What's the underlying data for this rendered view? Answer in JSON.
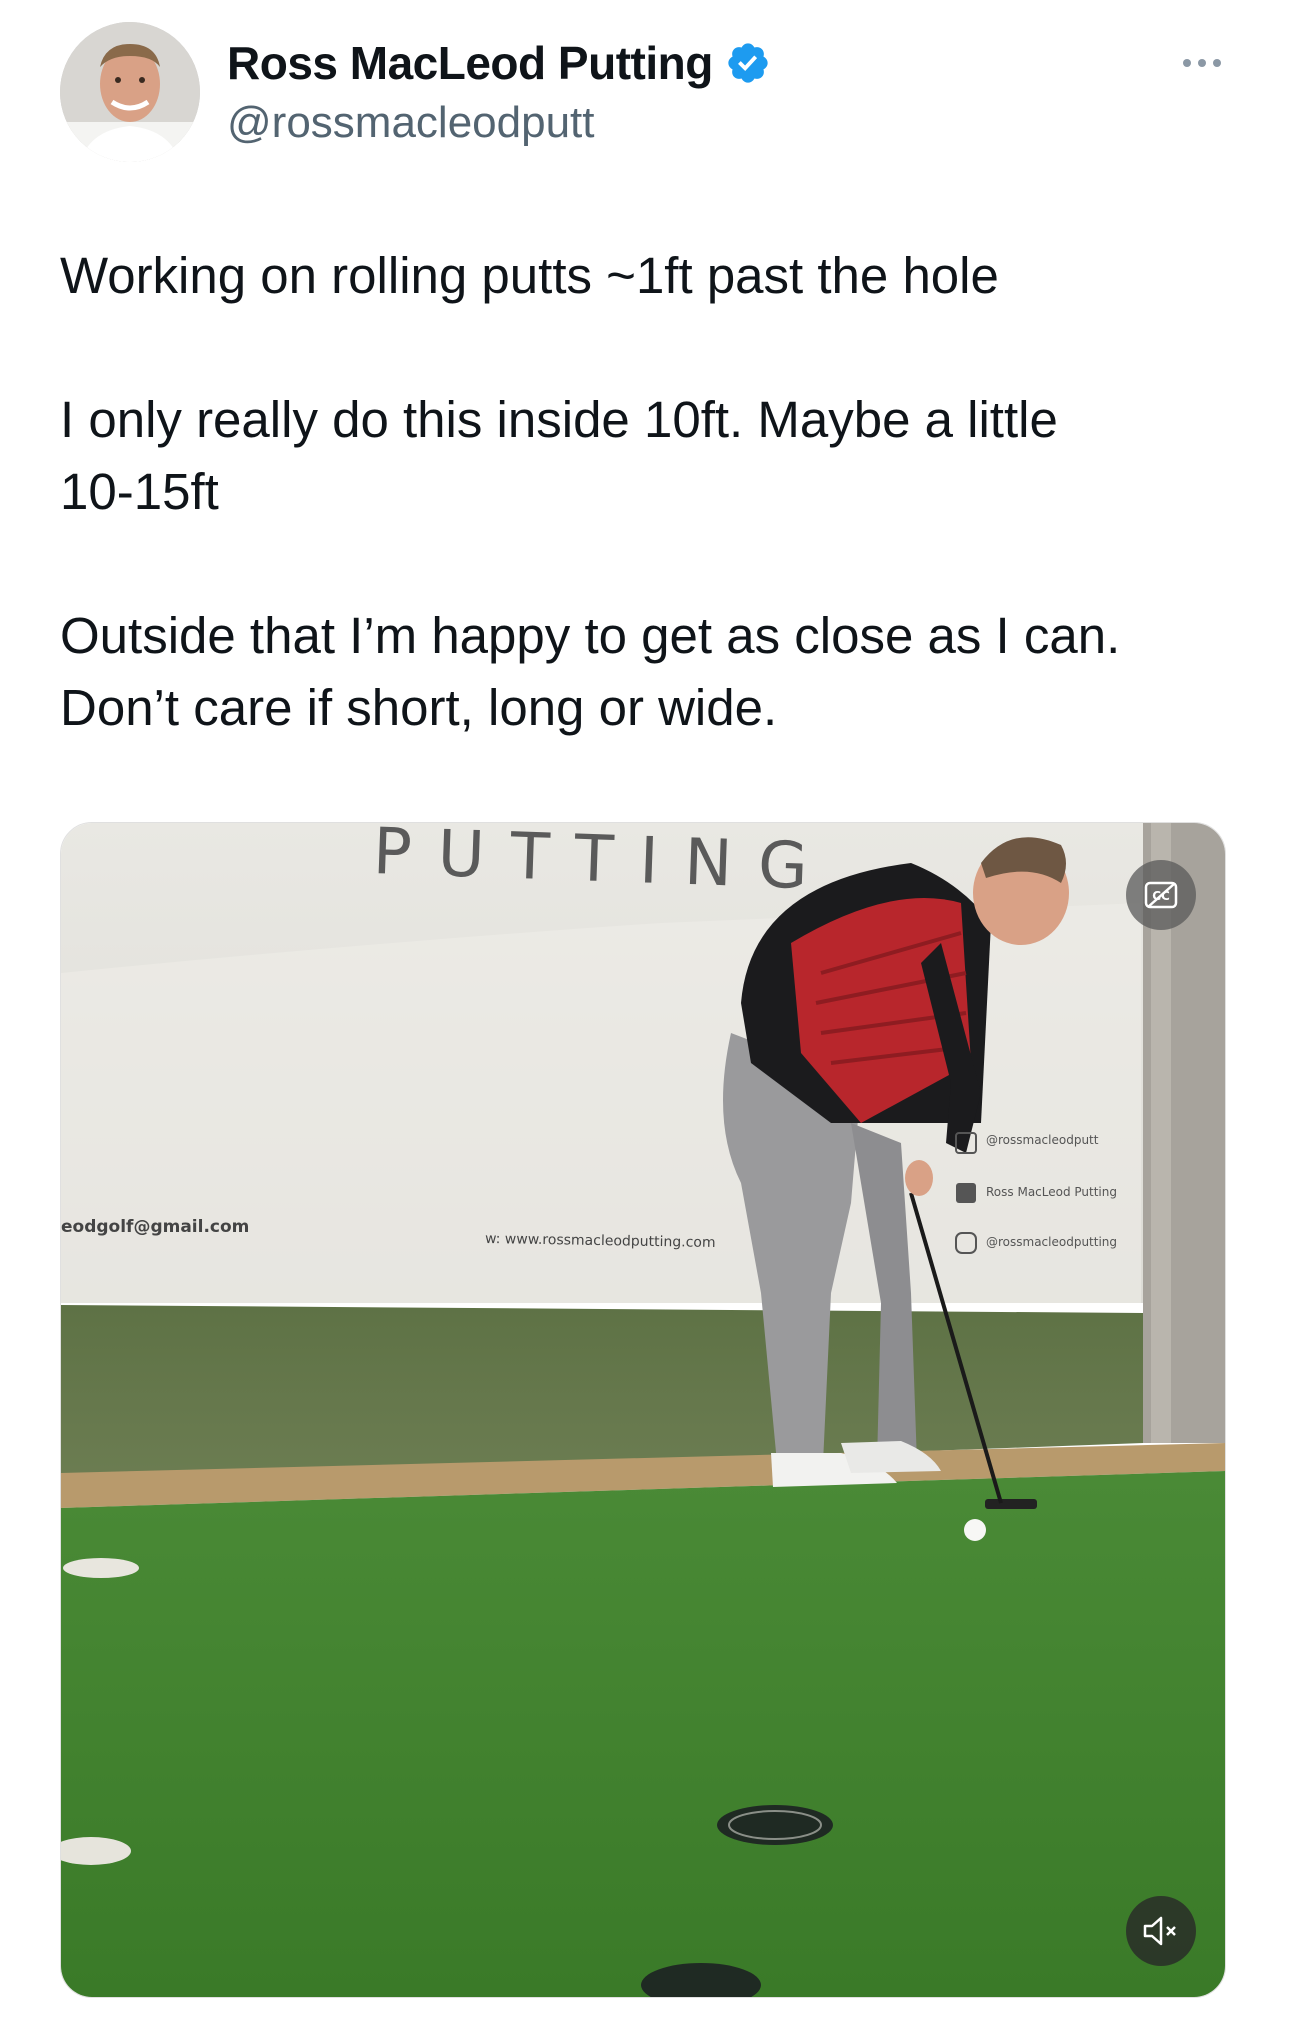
{
  "author": {
    "display_name": "Ross MacLeod Putting",
    "handle": "@rossmacleodputt",
    "verified": true,
    "avatar_icon": "avatar-photo"
  },
  "tweet": {
    "text": "Working on rolling putts ~1ft past the hole\n\nI only really do this inside 10ft. Maybe a little\n10-15ft\n\nOutside that I’m happy to get as close as I can.\nDon’t care if short, long or wide."
  },
  "media": {
    "banner": {
      "headline": "PUTTING",
      "email": "eodgolf@gmail.com",
      "website": "w: www.rossmacleodputting.com",
      "social_twitter": "@rossmacleodputt",
      "social_facebook": "Ross MacLeod Putting",
      "social_instagram": "@rossmacleodputting"
    },
    "controls": {
      "captions_icon": "cc-icon",
      "mute_icon": "muted-speaker-icon"
    }
  },
  "colors": {
    "verified_blue": "#1d9bf0",
    "text_primary": "#0f1419",
    "text_secondary": "#536471",
    "turf_green": "#3b7a2c",
    "vest_red": "#b8262c"
  }
}
